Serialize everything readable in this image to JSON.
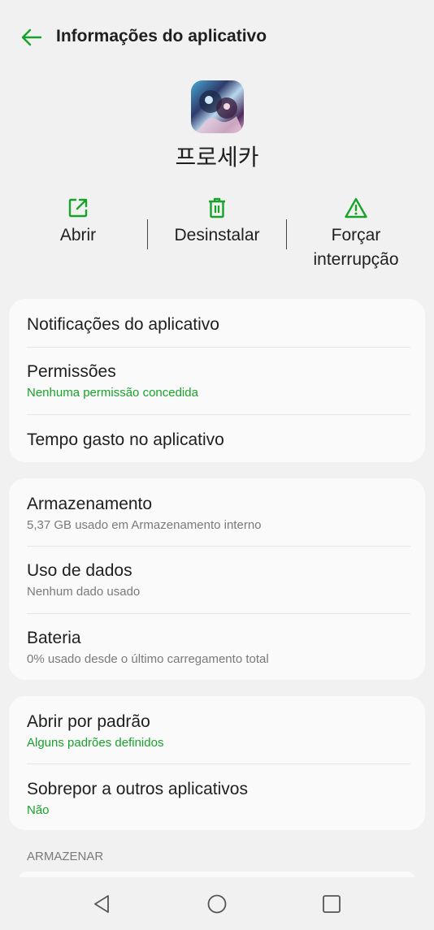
{
  "header": {
    "title": "Informações do aplicativo",
    "back_icon": "arrow-left-icon"
  },
  "app": {
    "name": "프로세카",
    "icon": "app-icon"
  },
  "actions": {
    "open_label": "Abrir",
    "uninstall_label": "Desinstalar",
    "force_label_line1": "Forçar",
    "force_label_line2": "interrupção"
  },
  "colors": {
    "accent": "#17a32a",
    "background": "#f1f1f1",
    "card": "#fafafa"
  },
  "card1": {
    "notifications": {
      "title": "Notificações do aplicativo"
    },
    "permissions": {
      "title": "Permissões",
      "subtitle": "Nenhuma permissão concedida"
    },
    "time_spent": {
      "title": "Tempo gasto no aplicativo"
    }
  },
  "card2": {
    "storage": {
      "title": "Armazenamento",
      "subtitle": "5,37 GB usado em Armazenamento interno"
    },
    "data_usage": {
      "title": "Uso de dados",
      "subtitle": "Nenhum dado usado"
    },
    "battery": {
      "title": "Bateria",
      "subtitle": "0% usado desde o último carregamento total"
    }
  },
  "card3": {
    "open_default": {
      "title": "Abrir por padrão",
      "subtitle": "Alguns padrões definidos"
    },
    "overlay": {
      "title": "Sobrepor a outros aplicativos",
      "subtitle": "Não"
    }
  },
  "section": {
    "store_label": "ARMAZENAR"
  },
  "navbar": {
    "back": "triangle-back-icon",
    "home": "circle-home-icon",
    "recents": "square-recents-icon"
  }
}
